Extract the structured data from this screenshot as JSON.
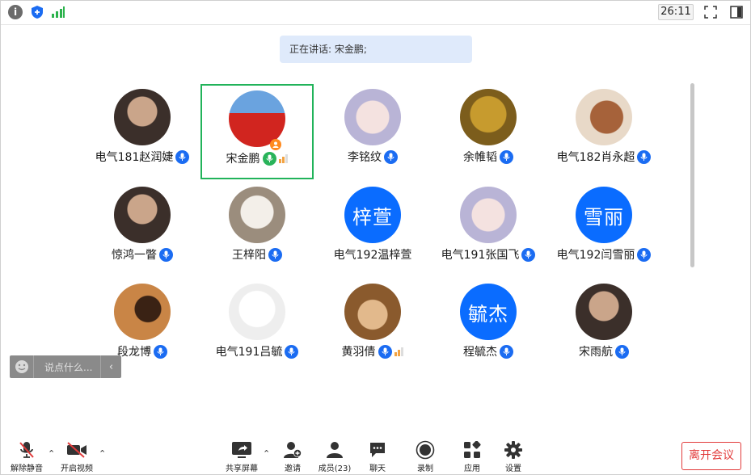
{
  "topbar": {
    "timer": "26:11",
    "icons": [
      "info-icon",
      "shield-icon",
      "signal-icon",
      "fullscreen-icon",
      "sidebar-toggle-icon"
    ]
  },
  "speaking": {
    "text": "正在讲话: 宋金鹏;"
  },
  "participants": [
    {
      "name": "电气181赵润婕",
      "avatar": "photo",
      "mic": "mic-icon"
    },
    {
      "name": "宋金鹏",
      "avatar": "flag-photo",
      "mic": "mic-active-icon",
      "speaking": true,
      "host": true
    },
    {
      "name": "李铭纹",
      "avatar": "anime-photo",
      "mic": "mic-icon"
    },
    {
      "name": "余帷韬",
      "avatar": "statue-photo",
      "mic": "mic-icon"
    },
    {
      "name": "电气182肖永超",
      "avatar": "dog-photo",
      "mic": "mic-icon"
    },
    {
      "name": "惊鸿一瞥",
      "avatar": "photo",
      "mic": "mic-icon"
    },
    {
      "name": "王梓阳",
      "avatar": "puppy-photo",
      "mic": "mic-icon"
    },
    {
      "name": "电气192温梓萱",
      "avatar": "梓萱",
      "mic": ""
    },
    {
      "name": "电气191张国飞",
      "avatar": "anime-photo",
      "mic": "mic-icon"
    },
    {
      "name": "电气192闫雪丽",
      "avatar": "雪丽",
      "mic": "mic-icon"
    },
    {
      "name": "段龙博",
      "avatar": "shadow-photo",
      "mic": "mic-icon"
    },
    {
      "name": "电气191吕毓",
      "avatar": "sketch-photo",
      "mic": "mic-icon"
    },
    {
      "name": "黄羽倩",
      "avatar": "cat-photo",
      "mic": "mic-icon",
      "speaking": true
    },
    {
      "name": "程毓杰",
      "avatar": "毓杰",
      "mic": "mic-icon"
    },
    {
      "name": "宋雨航",
      "avatar": "photo",
      "mic": "mic-icon"
    }
  ],
  "chat": {
    "placeholder": "说点什么..."
  },
  "toolbar": {
    "unmute": "解除静音",
    "start_video": "开启视频",
    "share_screen": "共享屏幕",
    "invite": "邀请",
    "members": "成员(23)",
    "chat": "聊天",
    "record": "录制",
    "apps": "应用",
    "settings": "设置",
    "leave": "离开会议"
  },
  "colors": {
    "accent": "#0a6cff",
    "speaking_border": "#21b35a",
    "leave": "#e23b3b"
  }
}
